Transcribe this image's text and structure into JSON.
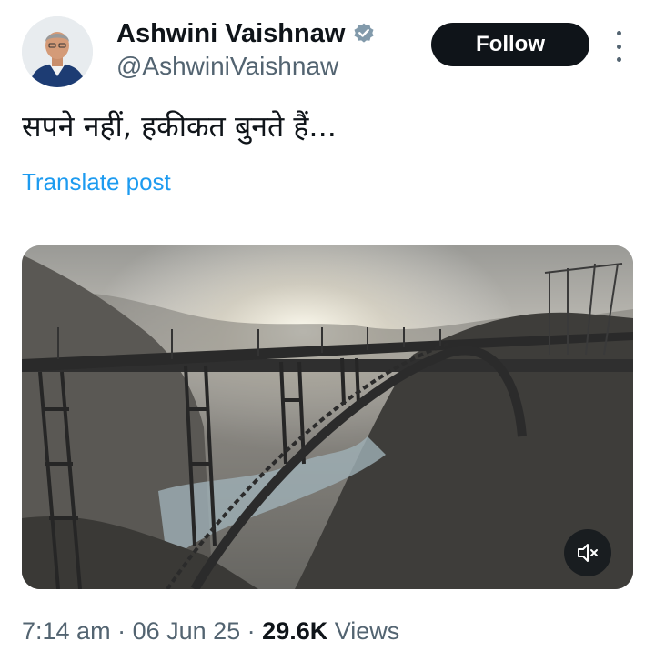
{
  "author": {
    "name": "Ashwini Vaishnaw",
    "handle": "@AshwiniVaishnaw",
    "verified": true,
    "verified_color": "#829aab"
  },
  "actions": {
    "follow_label": "Follow",
    "more_icon": "more-vertical-icon"
  },
  "post": {
    "text": "सपने नहीं, हकीकत बुनते हैं...",
    "translate_label": "Translate post"
  },
  "media": {
    "type": "video",
    "mute_icon": "volume-muted-icon"
  },
  "meta": {
    "time": "7:14 am",
    "separator": " · ",
    "date": "06 Jun 25",
    "views_count": "29.6K",
    "views_label": " Views"
  },
  "colors": {
    "link": "#1d9bf0",
    "text_primary": "#0f1419",
    "text_secondary": "#536471",
    "button_bg": "#0f1419"
  }
}
